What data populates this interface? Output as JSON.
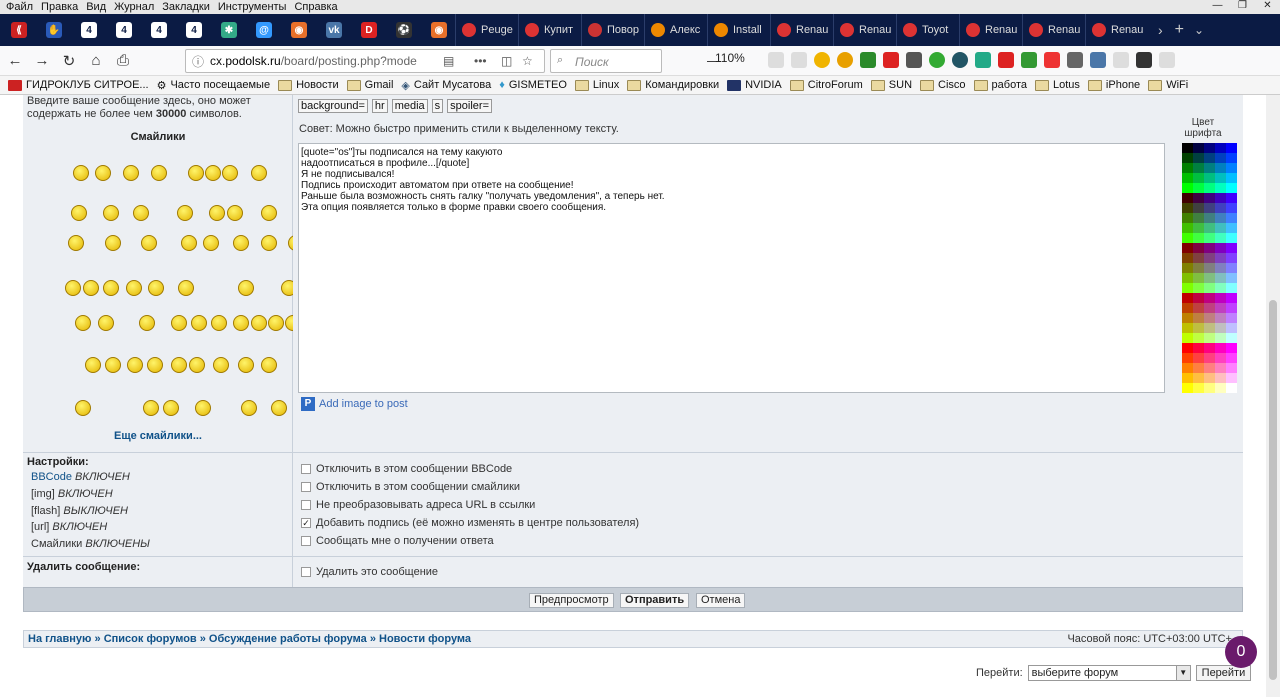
{
  "browser": {
    "menu": [
      "Файл",
      "Правка",
      "Вид",
      "Журнал",
      "Закладки",
      "Инструменты",
      "Справка"
    ],
    "tabs": [
      "Peuge",
      "Купит",
      "Повор",
      "Алекс",
      "Install",
      "Renau",
      "Renau",
      "Toyot",
      "Renau",
      "Renau",
      "Renau"
    ],
    "url_prefix": "cx.",
    "url_domain": "podolsk.ru",
    "url_path": "/board/posting.php?mode",
    "search_placeholder": "Поиск",
    "zoom": "110%",
    "bookmarks": [
      "ГИДРОКЛУБ СИТРОЕ...",
      "Часто посещаемые",
      "Новости",
      "Gmail",
      "Сайт Мусатова",
      "GISMETEO",
      "Linux",
      "Командировки",
      "NVIDIA",
      "CitroForum",
      "SUN",
      "Cisco",
      "работа",
      "Lotus",
      "iPhone",
      "WiFi"
    ],
    "badge_count": "0"
  },
  "editor": {
    "hint": "Введите ваше сообщение здесь, оно может содержать не более чем ",
    "hint_limit": "30000",
    "hint_suffix": " символов.",
    "smilies_title": "Смайлики",
    "more_smilies": "Еще смайлики...",
    "bbcode_buttons": [
      "background=",
      "hr",
      "media",
      "s",
      "spoiler="
    ],
    "advice": "Совет: Можно быстро применить стили к выделенному тексту.",
    "message": "[quote=\"os\"]ты подписался на тему какуюто\nнадоотписаться в профиле...[/quote]\nЯ не подписывался!\nПодпись происходит автоматом при ответе на сообщение!\nРаньше была возможность снять галку \"получать уведомления\", а теперь нет.\nЭта опция появляется только в форме правки своего сообщения.",
    "add_image": "Add image to post",
    "color_title": "Цвет шрифта"
  },
  "settings": {
    "title": "Настройки:",
    "items": [
      {
        "name": "BBCode",
        "state": "ВКЛЮЧЕН"
      },
      {
        "name": "[img]",
        "state": "ВКЛЮЧЕН"
      },
      {
        "name": "[flash]",
        "state": "ВЫКЛЮЧЕН"
      },
      {
        "name": "[url]",
        "state": "ВКЛЮЧЕН"
      },
      {
        "name": "Смайлики",
        "state": "ВКЛЮЧЕНЫ"
      }
    ],
    "checkboxes": [
      {
        "label": "Отключить в этом сообщении BBCode",
        "checked": false
      },
      {
        "label": "Отключить в этом сообщении смайлики",
        "checked": false
      },
      {
        "label": "Не преобразовывать адреса URL в ссылки",
        "checked": false
      },
      {
        "label": "Добавить подпись (её можно изменять в центре пользователя)",
        "checked": true
      },
      {
        "label": "Сообщать мне о получении ответа",
        "checked": false
      }
    ],
    "delete_title": "Удалить сообщение:",
    "delete_label": "Удалить это сообщение"
  },
  "actions": {
    "preview": "Предпросмотр",
    "submit": "Отправить",
    "cancel": "Отмена"
  },
  "footer": {
    "breadcrumb": [
      "На главную",
      "Список форумов",
      "Обсуждение работы форума",
      "Новости форума"
    ],
    "separator": "»",
    "timezone": "Часовой пояс: UTC+03:00 UTC+",
    "jump_label": "Перейти:",
    "jump_select": "выберите форум",
    "jump_button": "Перейти"
  }
}
